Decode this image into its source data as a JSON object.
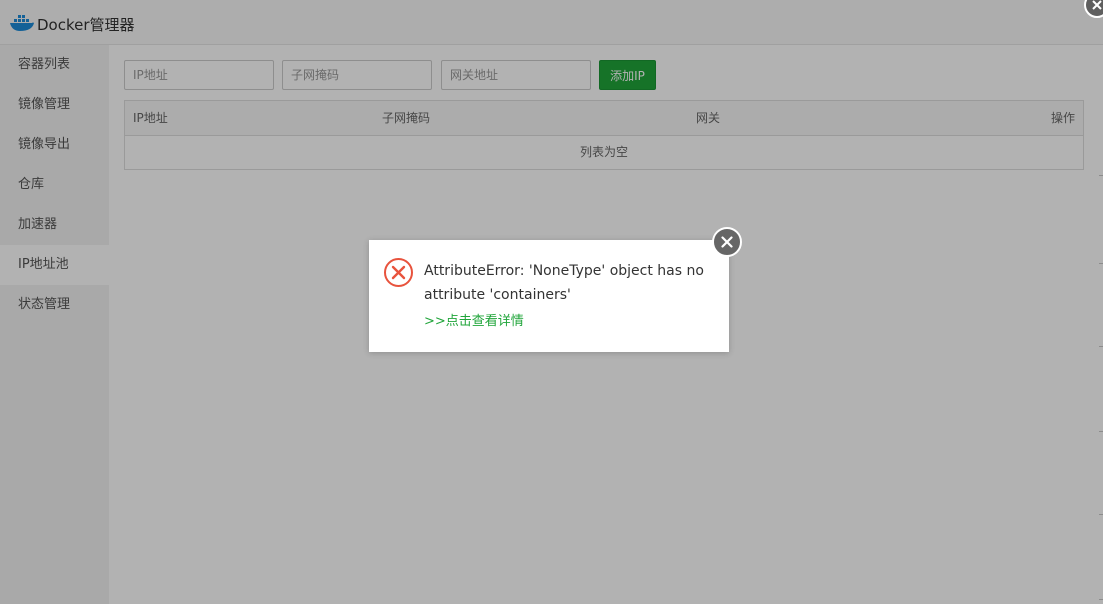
{
  "app": {
    "title": "Docker管理器",
    "logo_icon": "docker-whale-icon",
    "brand_color": "#1d8bd8"
  },
  "sidebar": {
    "items": [
      {
        "label": "容器列表",
        "active": false
      },
      {
        "label": "镜像管理",
        "active": false
      },
      {
        "label": "镜像导出",
        "active": false
      },
      {
        "label": "仓库",
        "active": false
      },
      {
        "label": "加速器",
        "active": false
      },
      {
        "label": "IP地址池",
        "active": true
      },
      {
        "label": "状态管理",
        "active": false
      }
    ]
  },
  "form": {
    "ip_placeholder": "IP地址",
    "ip_value": "",
    "mask_placeholder": "子网掩码",
    "mask_value": "",
    "gateway_placeholder": "网关地址",
    "gateway_value": "",
    "add_button": "添加IP",
    "add_button_color": "#20a53a"
  },
  "table": {
    "columns": [
      "IP地址",
      "子网掩码",
      "网关",
      "操作"
    ],
    "rows": [],
    "empty_text": "列表为空"
  },
  "dialog": {
    "message": "AttributeError: 'NoneType' object has no attribute 'containers'",
    "link_text": ">>点击查看详情",
    "icon": "error-x-circle-icon",
    "icon_color": "#e8533d",
    "link_color": "#20a53a",
    "close_icon": "close-icon"
  }
}
